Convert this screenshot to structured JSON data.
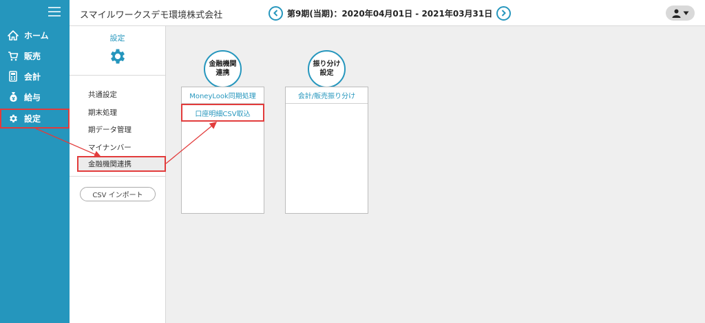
{
  "company": "スマイルワークスデモ環境株式会社",
  "period": "第9期(当期)：2020年04月01日 - 2021年03月31日",
  "sidebar": {
    "items": [
      {
        "label": "ホーム",
        "icon": "home-icon"
      },
      {
        "label": "販売",
        "icon": "cart-icon"
      },
      {
        "label": "会計",
        "icon": "calculator-icon"
      },
      {
        "label": "給与",
        "icon": "money-bag-icon"
      },
      {
        "label": "設定",
        "icon": "gear-icon"
      }
    ]
  },
  "settings": {
    "title": "設定",
    "menu": [
      "共通設定",
      "期末処理",
      "期データ管理",
      "マイナンバー",
      "金融機関連携"
    ],
    "csv_button": "CSV インポート"
  },
  "categories": [
    {
      "label_line1": "金融機関",
      "label_line2": "連携"
    },
    {
      "label_line1": "振り分け",
      "label_line2": "設定"
    }
  ],
  "cards": [
    {
      "header": "MoneyLook同期処理",
      "items": [
        "口座明細CSV取込"
      ]
    },
    {
      "header": "会計/販売振り分け",
      "items": []
    }
  ],
  "colors": {
    "accent": "#2596bd",
    "highlight": "#e23b3b",
    "background": "#efefef"
  }
}
